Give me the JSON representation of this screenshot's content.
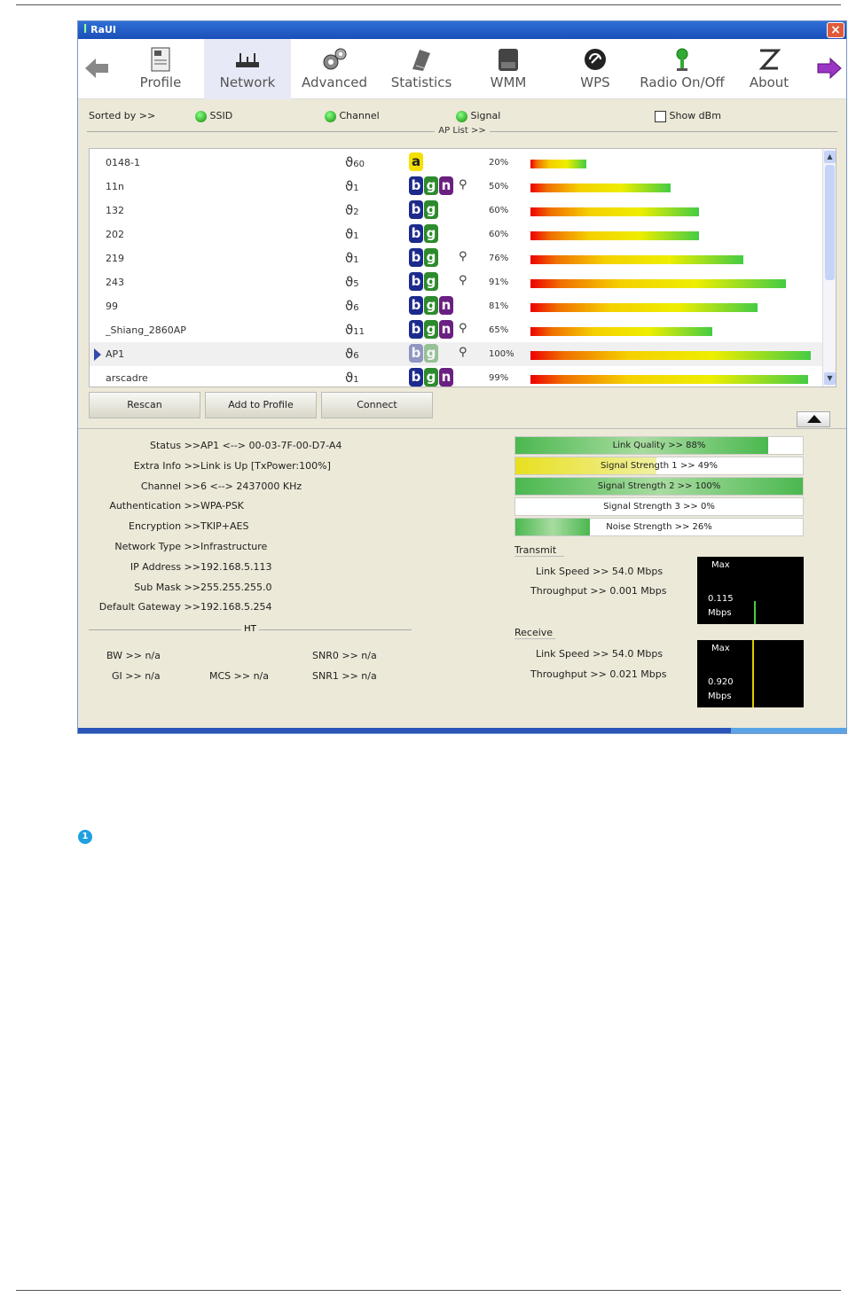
{
  "window": {
    "title": "RaUI"
  },
  "toolbar": {
    "items": [
      {
        "label": "Profile"
      },
      {
        "label": "Network"
      },
      {
        "label": "Advanced"
      },
      {
        "label": "Statistics"
      },
      {
        "label": "WMM"
      },
      {
        "label": "WPS"
      },
      {
        "label": "Radio On/Off"
      },
      {
        "label": "About"
      }
    ],
    "selected": "Network"
  },
  "sort": {
    "label": "Sorted by >>",
    "ssid": "SSID",
    "channel": "Channel",
    "signal": "Signal",
    "show_dbm": "Show dBm",
    "aplist_title": "AP List >>"
  },
  "aplist": [
    {
      "ssid": "0148-1",
      "channel": "60",
      "modes": [
        "a"
      ],
      "key": false,
      "pct": "20%",
      "signal": 20
    },
    {
      "ssid": "11n",
      "channel": "1",
      "modes": [
        "b",
        "g",
        "n"
      ],
      "key": true,
      "pct": "50%",
      "signal": 50
    },
    {
      "ssid": "132",
      "channel": "2",
      "modes": [
        "b",
        "g"
      ],
      "key": false,
      "pct": "60%",
      "signal": 60
    },
    {
      "ssid": "202",
      "channel": "1",
      "modes": [
        "b",
        "g"
      ],
      "key": false,
      "pct": "60%",
      "signal": 60
    },
    {
      "ssid": "219",
      "channel": "1",
      "modes": [
        "b",
        "g"
      ],
      "key": true,
      "pct": "76%",
      "signal": 76
    },
    {
      "ssid": "243",
      "channel": "5",
      "modes": [
        "b",
        "g"
      ],
      "key": true,
      "pct": "91%",
      "signal": 91
    },
    {
      "ssid": "99",
      "channel": "6",
      "modes": [
        "b",
        "g",
        "n"
      ],
      "key": false,
      "pct": "81%",
      "signal": 81
    },
    {
      "ssid": "_Shiang_2860AP",
      "channel": "11",
      "modes": [
        "b",
        "g",
        "n"
      ],
      "key": true,
      "pct": "65%",
      "signal": 65
    },
    {
      "ssid": "AP1",
      "channel": "6",
      "modes": [
        "b",
        "g"
      ],
      "key": true,
      "pct": "100%",
      "signal": 100,
      "selected": true
    },
    {
      "ssid": "arscadre",
      "channel": "1",
      "modes": [
        "b",
        "g",
        "n"
      ],
      "key": false,
      "pct": "99%",
      "signal": 99
    }
  ],
  "buttons": {
    "rescan": "Rescan",
    "add_profile": "Add to Profile",
    "connect": "Connect"
  },
  "info": [
    {
      "key": "Status >>",
      "value": "AP1 <--> 00-03-7F-00-D7-A4"
    },
    {
      "key": "Extra Info >>",
      "value": "Link is Up [TxPower:100%]"
    },
    {
      "key": "Channel >>",
      "value": "6 <--> 2437000 KHz"
    },
    {
      "key": "Authentication >>",
      "value": "WPA-PSK"
    },
    {
      "key": "Encryption >>",
      "value": "TKIP+AES"
    },
    {
      "key": "Network Type >>",
      "value": "Infrastructure"
    },
    {
      "key": "IP Address >>",
      "value": "192.168.5.113"
    },
    {
      "key": "Sub Mask >>",
      "value": "255.255.255.0"
    },
    {
      "key": "Default Gateway >>",
      "value": "192.168.5.254"
    }
  ],
  "ht": {
    "title": "HT",
    "bw": "BW >> n/a",
    "gi": "GI >> n/a",
    "mcs": "MCS >> n/a",
    "snr0": "SNR0 >> n/a",
    "snr1": "SNR1 >> n/a"
  },
  "meters": [
    {
      "label": "Link Quality >> 88%",
      "value": 88,
      "color": "#49b84f"
    },
    {
      "label": "Signal Strength 1 >> 49%",
      "value": 49,
      "color": "#e8e030"
    },
    {
      "label": "Signal Strength 2 >> 100%",
      "value": 100,
      "color": "#49b84f"
    },
    {
      "label": "Signal Strength 3 >> 0%",
      "value": 0,
      "color": "#49b84f"
    },
    {
      "label": "Noise Strength >> 26%",
      "value": 26,
      "color": "#49b84f"
    }
  ],
  "transmit": {
    "title": "Transmit",
    "link_speed": "Link Speed >> 54.0 Mbps",
    "throughput": "Throughput >> 0.001 Mbps",
    "graph_max": "Max",
    "graph_val": "0.115",
    "graph_unit": "Mbps"
  },
  "receive": {
    "title": "Receive",
    "link_speed": "Link Speed >> 54.0 Mbps",
    "throughput": "Throughput >> 0.021 Mbps",
    "graph_max": "Max",
    "graph_val": "0.920",
    "graph_unit": "Mbps"
  },
  "note": {
    "bullet": "1"
  },
  "colors": {
    "accent": "#2f6fd6",
    "selected_tab": "#e7e9f6",
    "panel": "#ece9d8"
  }
}
